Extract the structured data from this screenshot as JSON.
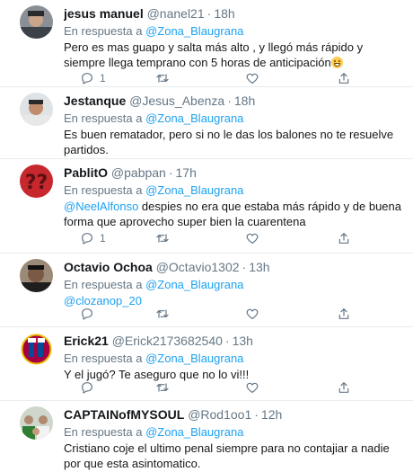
{
  "icons": {
    "reply": "reply-icon",
    "retweet": "retweet-icon",
    "like": "heart-icon",
    "share": "share-icon"
  },
  "colors": {
    "link": "#1da1f2",
    "secondary_text": "#657786",
    "primary_text": "#14171a",
    "divider": "#e6ecf0"
  },
  "replying_prefix": "En respuesta a",
  "tweets": [
    {
      "name": "jesus manuel",
      "handle": "@nanel21",
      "time": "18h",
      "replying_to": "@Zona_Blaugrana",
      "text": "Pero es mas guapo y salta más alto , y llegó más rápido y siempre llega temprano con 5 horas de anticipación",
      "emoji": "grinning-face-emoji",
      "reply_count": "1"
    },
    {
      "name": "Jestanque",
      "handle": "@Jesus_Abenza",
      "time": "18h",
      "replying_to": "@Zona_Blaugrana",
      "text": "Es buen rematador, pero si no le das los balones no te resuelve partidos."
    },
    {
      "name": "PablitO",
      "handle": "@pabpan",
      "time": "17h",
      "replying_to": "@Zona_Blaugrana",
      "mention": "@NeelAlfonso",
      "text": " despies no era que estaba más rápido y de buena forma que aprovecho super bien la cuarentena",
      "reply_count": "1"
    },
    {
      "name": "Octavio Ochoa",
      "handle": "@Octavio1302",
      "time": "13h",
      "replying_to": "@Zona_Blaugrana",
      "mention": "@clozanop_20"
    },
    {
      "name": "Erick21",
      "handle": "@Erick2173682540",
      "time": "13h",
      "replying_to": "@Zona_Blaugrana",
      "text": "Y el jugó? Te aseguro que no lo vi!!!"
    },
    {
      "name": "CAPTAINofMYSOUL",
      "handle": "@Rod1oo1",
      "time": "12h",
      "replying_to": "@Zona_Blaugrana",
      "text": "Cristiano coje el ultimo penal siempre para no contajiar a nadie por que esta asintomatico."
    }
  ]
}
